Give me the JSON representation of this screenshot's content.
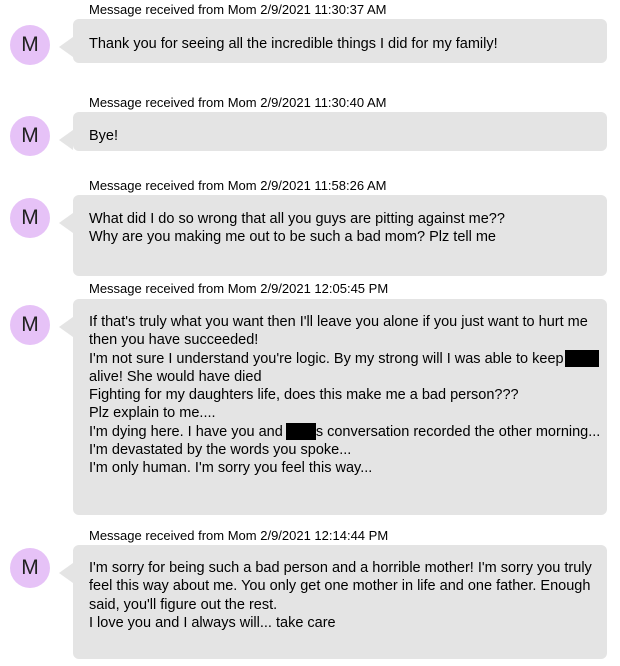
{
  "messages": [
    {
      "header": "Message received from Mom 2/9/2021 11:30:37 AM",
      "avatar": "M",
      "lines": [
        "Thank you for seeing all the incredible things I did for my family!"
      ]
    },
    {
      "header": "Message received from Mom 2/9/2021 11:30:40 AM",
      "avatar": "M",
      "lines": [
        "Bye!"
      ]
    },
    {
      "header": "Message received from Mom 2/9/2021 11:58:26 AM",
      "avatar": "M",
      "lines": [
        "What did I do so wrong that all you guys are pitting against me??",
        "Why are you making me out to be such a bad mom? Plz tell me"
      ]
    },
    {
      "header": "Message received from Mom 2/9/2021 12:05:45 PM",
      "avatar": "M",
      "lines": [
        "If that's truly what you want then I'll leave you alone if you just want to hurt me",
        "then you have succeeded!",
        "I'm not sure I understand you're logic. By my strong will I was able to keep",
        "alive! She would have died",
        "Fighting for my daughters life, does this make me a bad person???",
        "Plz explain to me....",
        "I'm dying here. I have you and",
        "s conversation recorded the other morning...",
        "I'm devastated by the words you spoke...",
        "I'm only human. I'm sorry you feel this way..."
      ]
    },
    {
      "header": "Message received from Mom 2/9/2021 12:14:44 PM",
      "avatar": "M",
      "lines": [
        "I'm sorry for being such a bad person and a horrible mother! I'm sorry you truly",
        "feel this way about me. You only get one mother in life and one father. Enough",
        "said, you'll figure out the rest.",
        "I love you and I always will... take care"
      ]
    }
  ]
}
